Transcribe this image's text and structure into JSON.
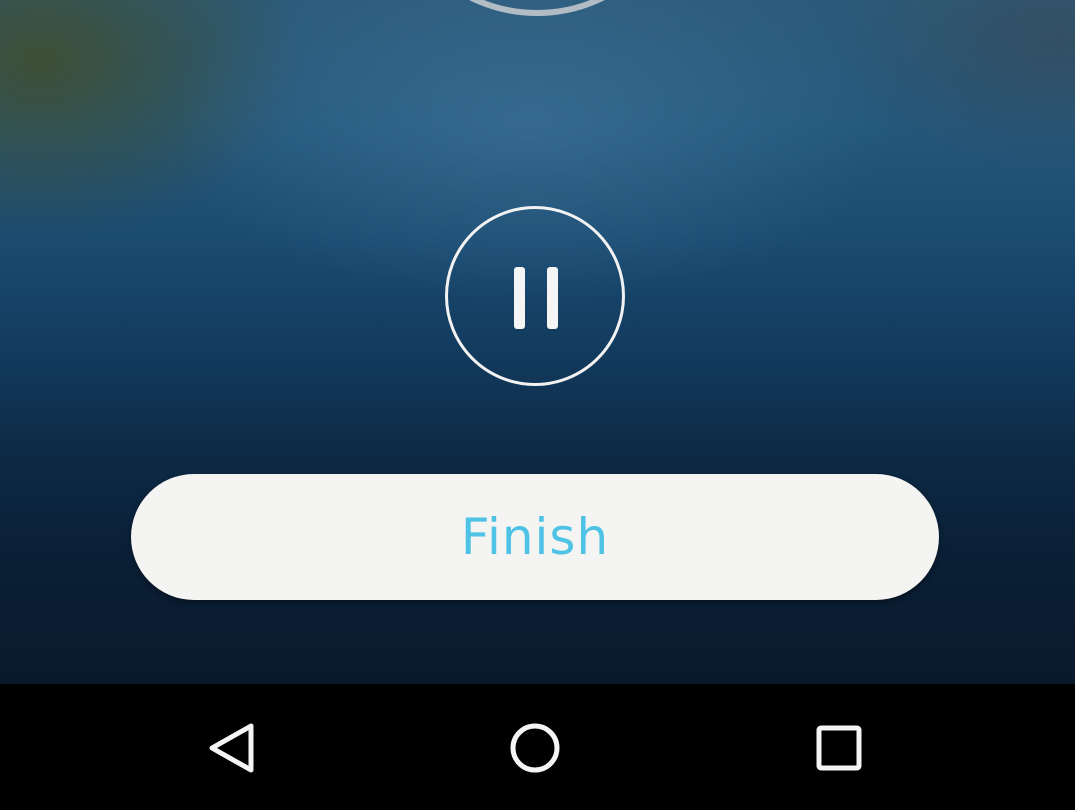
{
  "player": {
    "pause_icon": "pause-icon",
    "finish_label": "Finish"
  },
  "navigation_bar": {
    "back_icon": "back-triangle-icon",
    "home_icon": "home-circle-icon",
    "recents_icon": "recents-square-icon"
  },
  "colors": {
    "accent": "#4ec3e6",
    "button_background": "#f4f4f2",
    "icon_white": "#f5f5f5",
    "nav_background": "#000000"
  }
}
